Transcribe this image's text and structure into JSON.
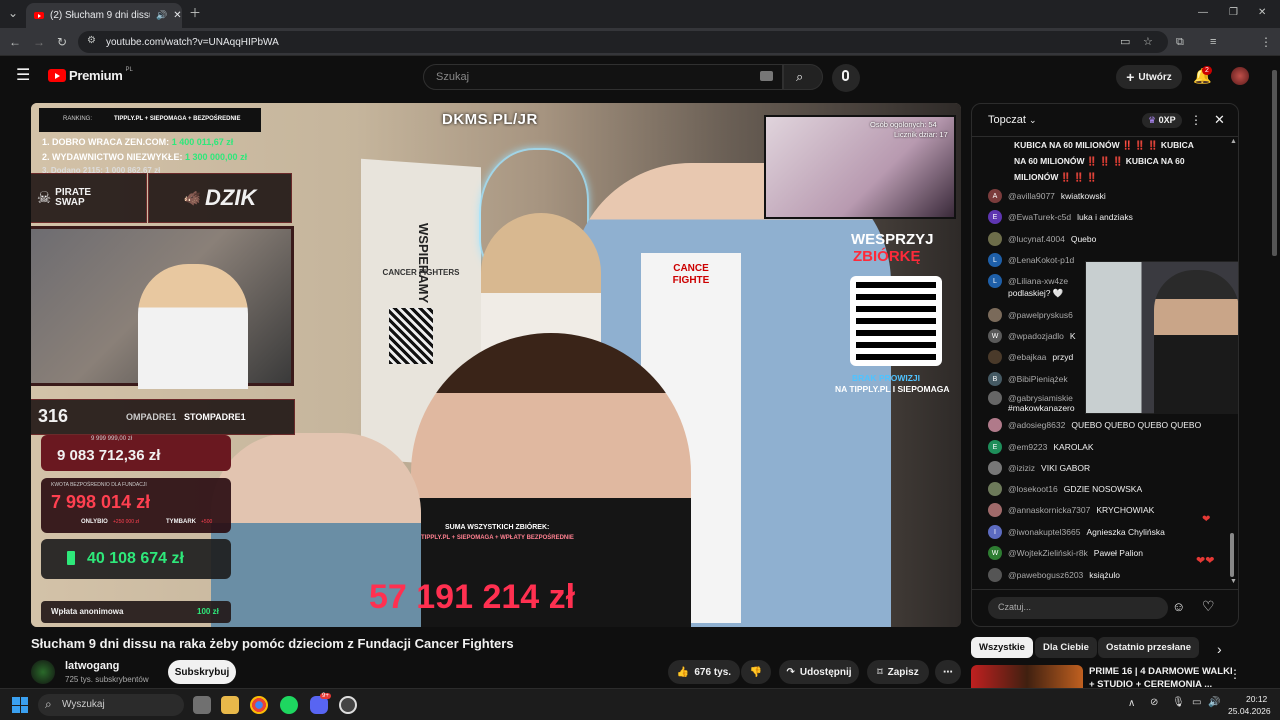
{
  "browser": {
    "tab_title": "(2) Słucham 9 dni dissu na r",
    "url": "youtube.com/watch?v=UNAqqHIPbWA"
  },
  "header": {
    "logo_text": "Premium",
    "region": "PL",
    "search_placeholder": "Szukaj",
    "create_label": "Utwórz",
    "notifications_count": "2"
  },
  "overlay": {
    "ranking_label": "RANKING:",
    "ranking_sources": "TIPPLY.PL + SIEPOMAGA + BEZPOŚREDNIE",
    "rank1_name": "1. DOBRO WRACA ZEN.COM:",
    "rank1_value": "1 400 011,67 zł",
    "rank2_name": "2. WYDAWNICTWO NIEZWYKŁE:",
    "rank2_value": "1 300 000,00 zł",
    "rank3_partial": "3. Dodano 2115: 1 000 862,67 zł",
    "sponsor1": "PIRATE SWAP",
    "sponsor2": "DZIK",
    "viewer_count": "316",
    "channel_bar": "OMPADRE1",
    "channel_bar_yt": "STOMPADRE1",
    "goal_small": "9 999 999,00 zł",
    "goal_value": "9 083 712,36 zł",
    "fund_label": "KWOTA BEZPOŚREDNIO DLA FUNDACJI",
    "fund_value": "7 998 014 zł",
    "fund_sub1_name": "ONLYBIO",
    "fund_sub1_val": "+250 000 zł",
    "fund_sub2_name": "TYMBARK",
    "fund_sub2_val": "+500",
    "battery_value": "40 108 674 zł",
    "anon_label": "Wpłata anonimowa",
    "anon_value": "100 zł",
    "top_url": "DKMS.PL/JR",
    "persons_label": "Osób ogolonych: 54",
    "counter_label": "Licznik dziar: 17",
    "cta_line1": "WESPRZYJ",
    "cta_line2": "ZBIÓRKĘ",
    "no_fee_line1": "BRAK PROWIZJI",
    "no_fee_line2": "NA TIPPLY.PL I SIEPOMAGA",
    "sum_label": "SUMA WSZYSTKICH ZBIÓREK:",
    "sum_sources": "TIPPLY.PL + SIEPOMAGA + WPŁATY BEZPOŚREDNIE",
    "sum_value": "57 191 214 zł",
    "banner_text": "WSPIERAMY",
    "banner_sub": "CANCER FIGHTERS",
    "shirt_text": "CANCE FIGHTE"
  },
  "chat": {
    "header_label": "Topczat",
    "xp_label": "0XP",
    "pinned_text_1": "KUBICA NA 60 MILIONÓW ‼️ ‼️ ‼️ KUBICA",
    "pinned_text_2": "NA 60 MILIONÓW ‼️ ‼️ ‼️ KUBICA NA 60",
    "pinned_text_3": "MILIONÓW ‼️ ‼️ ‼️",
    "messages": [
      {
        "initial": "A",
        "color": "#7b3c3c",
        "author": "@avilla9077",
        "text": "kwiatkowski"
      },
      {
        "initial": "E",
        "color": "#5e35b1",
        "author": "@EwaTurek-c5d",
        "text": "luka i andziaks"
      },
      {
        "initial": "",
        "color": "#6d6d4a",
        "author": "@lucynaf.4004",
        "text": "Quebo"
      },
      {
        "initial": "L",
        "color": "#1e5fa8",
        "author": "@LenaKokot-p1d",
        "text": ""
      },
      {
        "initial": "L",
        "color": "#1e5fa8",
        "author": "@Liliana-xw4ze",
        "text": ""
      },
      {
        "initial": "",
        "color": "#555",
        "author": "podlaskiej? 🤍",
        "text": ""
      },
      {
        "initial": "",
        "color": "#7a6a5a",
        "author": "@pawelpryskus6",
        "text": ""
      },
      {
        "initial": "W",
        "color": "#5a5a5a",
        "author": "@wpadozjadlo",
        "text": "K"
      },
      {
        "initial": "",
        "color": "#4a3a2a",
        "author": "@ebajkaa",
        "text": "przyd"
      },
      {
        "initial": "B",
        "color": "#455a64",
        "author": "@BibiPieniążek",
        "text": ""
      },
      {
        "initial": "",
        "color": "#666",
        "author": "@gabrysiamiskie",
        "text": ""
      },
      {
        "initial": "",
        "color": "#666",
        "author": "#makowkanazero",
        "text": ""
      },
      {
        "initial": "",
        "color": "#b07a8a",
        "author": "@adosieg8632",
        "text": "QUEBO QUEBO QUEBO QUEBO"
      },
      {
        "initial": "E",
        "color": "#1e8e5a",
        "author": "@em9223",
        "text": "KAROLAK"
      },
      {
        "initial": "",
        "color": "#777",
        "author": "@iziziz",
        "text": "VIKI GABOR"
      },
      {
        "initial": "",
        "color": "#6d7a5a",
        "author": "@losekoot16",
        "text": "GDZIE NOSOWSKA"
      },
      {
        "initial": "",
        "color": "#a06a6a",
        "author": "@annaskornicka7307",
        "text": "KRYCHOWIAK"
      },
      {
        "initial": "I",
        "color": "#5c6bc0",
        "author": "@iwonakuptel3665",
        "text": "Agnieszka Chylińska"
      },
      {
        "initial": "W",
        "color": "#2e7d32",
        "author": "@WojtekZieliński-r8k",
        "text": "Paweł Palion"
      },
      {
        "initial": "",
        "color": "#555",
        "author": "@pawebogusz6203",
        "text": "książulo"
      }
    ],
    "input_placeholder": "Czatuj..."
  },
  "video": {
    "title": "Słucham 9 dni dissu na raka żeby pomóc dzieciom z Fundacji Cancer Fighters",
    "channel_name": "latwogang",
    "subscribers": "725 tys. subskrybentów",
    "subscribe_label": "Subskrybuj",
    "likes": "676 tys.",
    "share_label": "Udostępnij",
    "save_label": "Zapisz"
  },
  "chips": {
    "all": "Wszystkie",
    "for_you": "Dla Ciebie",
    "recent": "Ostatnio przesłane"
  },
  "recommendation": {
    "title_line1": "PRIME 16 | 4 DARMOWE WALKI",
    "title_line2": "+ STUDIO + CEREMONIA ..."
  },
  "taskbar": {
    "search_label": "Wyszukaj",
    "time": "20:12",
    "date": "25.04.2026",
    "discord_badge": "9+"
  }
}
